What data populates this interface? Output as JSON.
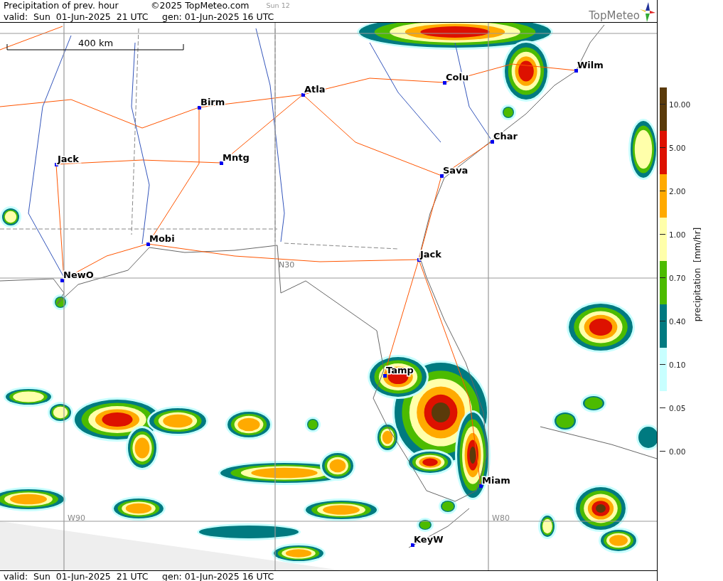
{
  "header": {
    "title": "Precipitation of prev. hour",
    "copyright": "©2025 TopMeteo.com",
    "run": "Sun 12",
    "valid": "valid:  Sun  01-Jun-2025  21 UTC",
    "generated": "gen: 01-Jun-2025 16 UTC",
    "logo": "TopMeteo"
  },
  "map": {
    "scale": "400 km",
    "grid_labels": [
      {
        "text": "N30",
        "kind": "lat"
      },
      {
        "text": "W90",
        "kind": "lon"
      },
      {
        "text": "W80",
        "kind": "lon"
      }
    ],
    "cities": [
      {
        "name": "Birm"
      },
      {
        "name": "Atla"
      },
      {
        "name": "Colu"
      },
      {
        "name": "Wilm"
      },
      {
        "name": "Jack"
      },
      {
        "name": "Mntg"
      },
      {
        "name": "Char"
      },
      {
        "name": "Sava"
      },
      {
        "name": "Mobi"
      },
      {
        "name": "Jack"
      },
      {
        "name": "NewO"
      },
      {
        "name": "Tamp"
      },
      {
        "name": "Miam"
      },
      {
        "name": "KeyW"
      }
    ]
  },
  "footer": {
    "valid": "valid:  Sun  01-Jun-2025  21 UTC",
    "generated": "gen: 01-Jun-2025 16 UTC"
  },
  "legend": {
    "title": "precipitation  [mm/hr]",
    "ticks": [
      "10.00",
      "5.00",
      "2.00",
      "1.00",
      "0.70",
      "0.40",
      "0.10",
      "0.05",
      "0.00"
    ],
    "bands": [
      {
        "color": "#5a3a0a"
      },
      {
        "color": "#dd1100"
      },
      {
        "color": "#ffaa00"
      },
      {
        "color": "#ffffaa"
      },
      {
        "color": "#4cbb00"
      },
      {
        "color": "#007a80"
      },
      {
        "color": "#c8ffff"
      }
    ]
  }
}
